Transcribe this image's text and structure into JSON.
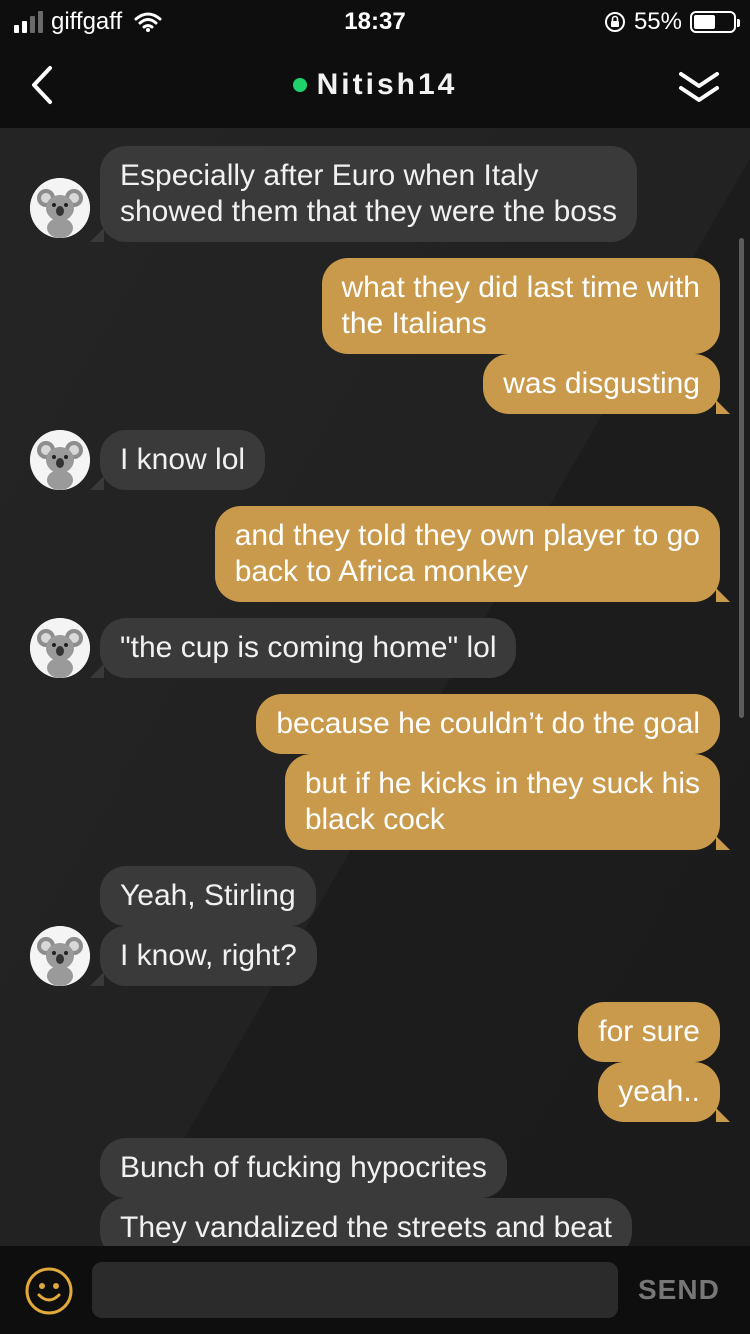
{
  "status_bar": {
    "carrier": "giffgaff",
    "time": "18:37",
    "battery_percent": "55%",
    "battery_level": 0.55
  },
  "header": {
    "title": "Nitish14",
    "online_color": "#1fd26a"
  },
  "messages": [
    {
      "side": "in",
      "lines": [
        "Especially after Euro when Italy",
        "showed them that they were the boss"
      ]
    },
    {
      "side": "out",
      "lines": [
        "what they did last time with",
        "the Italians"
      ]
    },
    {
      "side": "out",
      "lines": [
        "was disgusting"
      ]
    },
    {
      "side": "in",
      "lines": [
        "I know lol"
      ]
    },
    {
      "side": "out",
      "lines": [
        "and they told they own player to go",
        "back to Africa monkey"
      ]
    },
    {
      "side": "in",
      "lines": [
        "\"the cup is coming home\" lol"
      ]
    },
    {
      "side": "out",
      "lines": [
        "because he couldn’t do the goal"
      ]
    },
    {
      "side": "out",
      "lines": [
        "but if he kicks in they suck his",
        "black cock"
      ]
    },
    {
      "side": "in",
      "lines": [
        "Yeah, Stirling"
      ]
    },
    {
      "side": "in",
      "lines": [
        "I know, right?"
      ]
    },
    {
      "side": "out",
      "lines": [
        "for sure"
      ]
    },
    {
      "side": "out",
      "lines": [
        "yeah.."
      ]
    },
    {
      "side": "in",
      "lines": [
        "Bunch of fucking hypocrites"
      ]
    },
    {
      "side": "in",
      "lines": [
        "They vandalized the streets and beat"
      ]
    }
  ],
  "composer": {
    "placeholder": "",
    "send_label": "SEND"
  },
  "colors": {
    "outgoing_bubble": "#c99a4b",
    "incoming_bubble": "#3a3a3a",
    "accent_emoji": "#e0a93a"
  }
}
